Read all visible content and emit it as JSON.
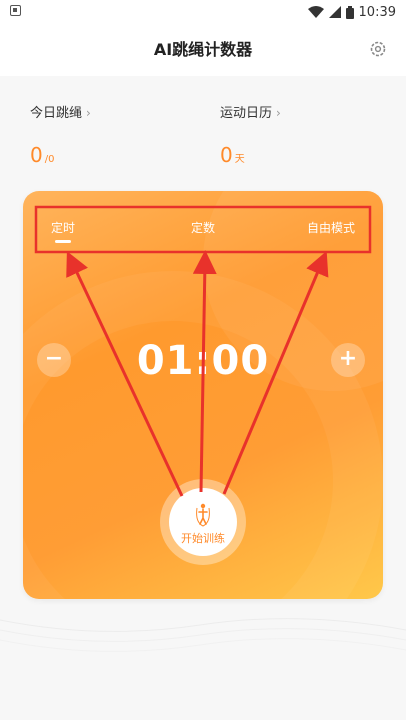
{
  "status_bar": {
    "time": "10:39"
  },
  "header": {
    "title": "AI跳绳计数器"
  },
  "stats": {
    "today": {
      "label": "今日跳绳",
      "value": "0",
      "unit": "/0"
    },
    "calendar": {
      "label": "运动日历",
      "value": "0",
      "unit": "天"
    }
  },
  "card": {
    "tabs": [
      "定时",
      "定数",
      "自由模式"
    ],
    "selected_tab": "定时",
    "timer": "01:00",
    "minus": "−",
    "plus": "+",
    "start_label": "开始训练"
  },
  "colors": {
    "accent": "#ff8a2a",
    "annotation": "#e8322b"
  }
}
